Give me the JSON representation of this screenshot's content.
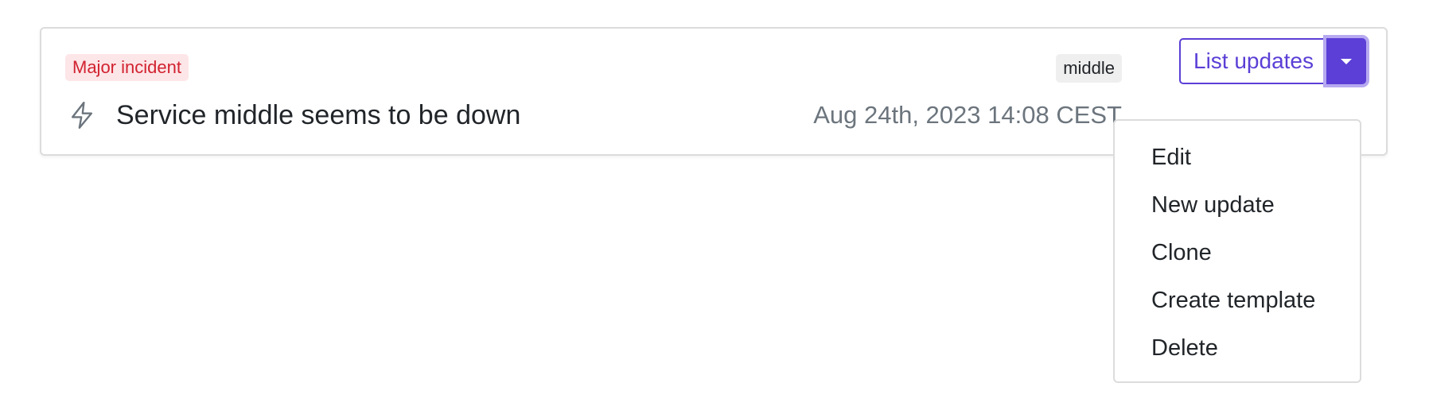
{
  "incident": {
    "type_label": "Major incident",
    "title": "Service middle seems to be down",
    "service_tag": "middle",
    "timestamp": "Aug 24th, 2023 14:08 CEST",
    "icon": "lightning-bolt-icon"
  },
  "actions": {
    "list_updates_label": "List updates",
    "dropdown_icon": "caret-down-icon",
    "menu_items": [
      {
        "label": "Edit"
      },
      {
        "label": "New update"
      },
      {
        "label": "Clone"
      },
      {
        "label": "Create template"
      },
      {
        "label": "Delete"
      }
    ]
  },
  "colors": {
    "accent": "#5b3fd6",
    "danger_text": "#d1222f",
    "danger_bg": "#fde6e8",
    "muted_text": "#6c757d"
  }
}
